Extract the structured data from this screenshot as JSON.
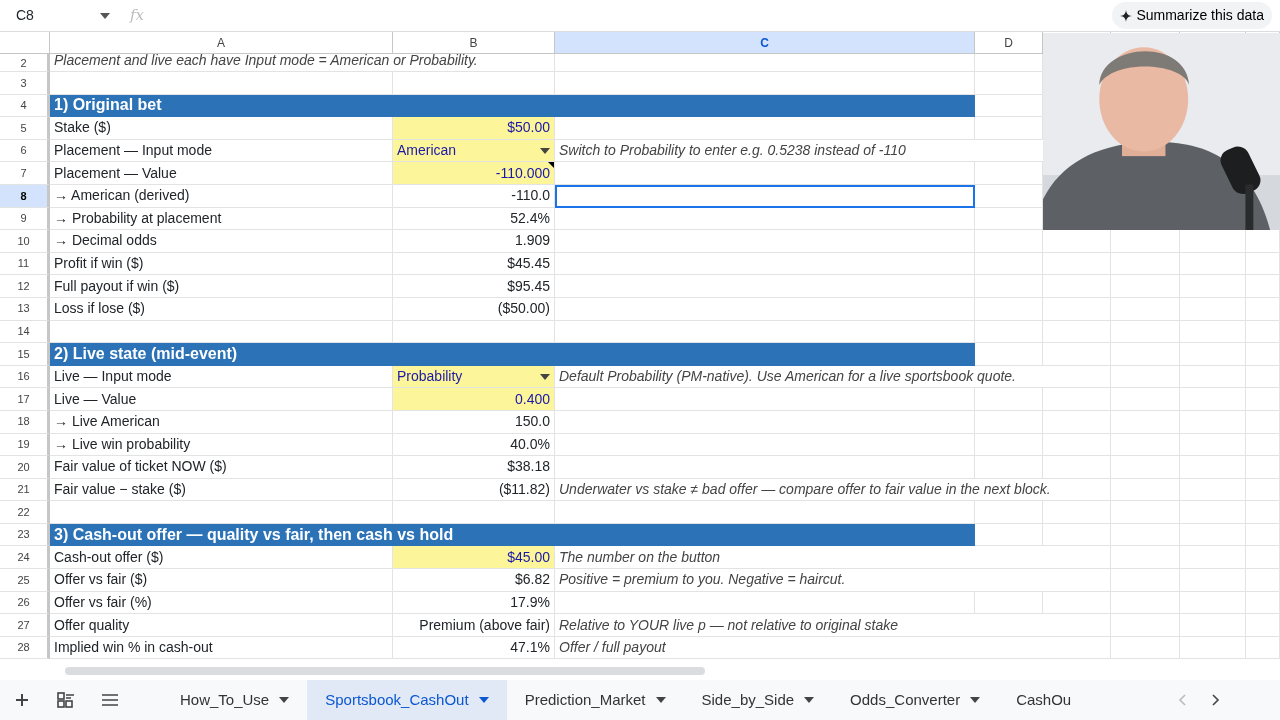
{
  "name_box": "C8",
  "formula_label": "fx",
  "summarize_button": "Summarize this data",
  "columns": [
    {
      "label": "A",
      "selected": false
    },
    {
      "label": "B",
      "selected": false
    },
    {
      "label": "C",
      "selected": true
    },
    {
      "label": "D",
      "selected": false
    }
  ],
  "rows": [
    {
      "number": "2",
      "kind": "note",
      "text": "Placement and live each have Input mode = American or Probability."
    },
    {
      "number": "3",
      "kind": "blank"
    },
    {
      "number": "4",
      "kind": "section",
      "title": "1) Original bet"
    },
    {
      "number": "5",
      "kind": "field",
      "label": "Stake ($)",
      "value": "$50.00",
      "input": true,
      "dropdown": false
    },
    {
      "number": "6",
      "kind": "field",
      "label": "Placement — Input mode",
      "value": "American",
      "input": true,
      "dropdown": true,
      "note": "Switch to Probability to enter e.g. 0.5238 instead of -110"
    },
    {
      "number": "7",
      "kind": "field",
      "label": "Placement — Value",
      "value": "-110.000",
      "input": true,
      "dropdown": false,
      "comment": true
    },
    {
      "number": "8",
      "kind": "field",
      "label": "→ American (derived)",
      "value": "-110.0",
      "input": false,
      "dropdown": false,
      "selected": true
    },
    {
      "number": "9",
      "kind": "field",
      "label": "→ Probability at placement",
      "value": "52.4%",
      "input": false,
      "dropdown": false
    },
    {
      "number": "10",
      "kind": "field",
      "label": "→ Decimal odds",
      "value": "1.909",
      "input": false,
      "dropdown": false
    },
    {
      "number": "11",
      "kind": "field",
      "label": "Profit if win ($)",
      "value": "$45.45",
      "input": false,
      "dropdown": false
    },
    {
      "number": "12",
      "kind": "field",
      "label": "Full payout if win ($)",
      "value": "$95.45",
      "input": false,
      "dropdown": false
    },
    {
      "number": "13",
      "kind": "field",
      "label": "Loss if lose ($)",
      "value": "($50.00)",
      "input": false,
      "dropdown": false
    },
    {
      "number": "14",
      "kind": "blank"
    },
    {
      "number": "15",
      "kind": "section",
      "title": "2) Live state (mid-event)"
    },
    {
      "number": "16",
      "kind": "field",
      "label": "Live — Input mode",
      "value": "Probability",
      "input": true,
      "dropdown": true,
      "note": "Default Probability (PM-native). Use American for a live sportsbook quote."
    },
    {
      "number": "17",
      "kind": "field",
      "label": "Live — Value",
      "value": "0.400",
      "input": true,
      "dropdown": false
    },
    {
      "number": "18",
      "kind": "field",
      "label": "→ Live American",
      "value": "150.0",
      "input": false,
      "dropdown": false
    },
    {
      "number": "19",
      "kind": "field",
      "label": "→ Live win probability",
      "value": "40.0%",
      "input": false,
      "dropdown": false
    },
    {
      "number": "20",
      "kind": "field",
      "label": "Fair value of ticket NOW ($)",
      "value": "$38.18",
      "input": false,
      "dropdown": false
    },
    {
      "number": "21",
      "kind": "field",
      "label": "Fair value − stake ($)",
      "value": "($11.82)",
      "input": false,
      "dropdown": false,
      "note": "Underwater vs stake ≠ bad offer — compare offer to fair value in the next block."
    },
    {
      "number": "22",
      "kind": "blank"
    },
    {
      "number": "23",
      "kind": "section",
      "title": "3) Cash-out offer — quality vs fair, then cash vs hold"
    },
    {
      "number": "24",
      "kind": "field",
      "label": "Cash-out offer ($)",
      "value": "$45.00",
      "input": true,
      "dropdown": false,
      "note": "The number on the button"
    },
    {
      "number": "25",
      "kind": "field",
      "label": "Offer vs fair ($)",
      "value": "$6.82",
      "input": false,
      "dropdown": false,
      "note": "Positive = premium to you. Negative = haircut."
    },
    {
      "number": "26",
      "kind": "field",
      "label": "Offer vs fair (%)",
      "value": "17.9%",
      "input": false,
      "dropdown": false
    },
    {
      "number": "27",
      "kind": "field",
      "label": "Offer quality",
      "value": "Premium (above fair)",
      "input": false,
      "dropdown": false,
      "note": "Relative to YOUR live p — not relative to original stake"
    },
    {
      "number": "28",
      "kind": "field",
      "label": "Implied win % in cash-out",
      "value": "47.1%",
      "input": false,
      "dropdown": false,
      "note": "Offer / full payout"
    }
  ],
  "sheet_tabs": [
    {
      "label": "How_To_Use",
      "selected": false
    },
    {
      "label": "Sportsbook_CashOut",
      "selected": true
    },
    {
      "label": "Prediction_Market",
      "selected": false
    },
    {
      "label": "Side_by_Side",
      "selected": false
    },
    {
      "label": "Odds_Converter",
      "selected": false
    },
    {
      "label": "CashOu",
      "selected": false,
      "cut": true
    }
  ]
}
